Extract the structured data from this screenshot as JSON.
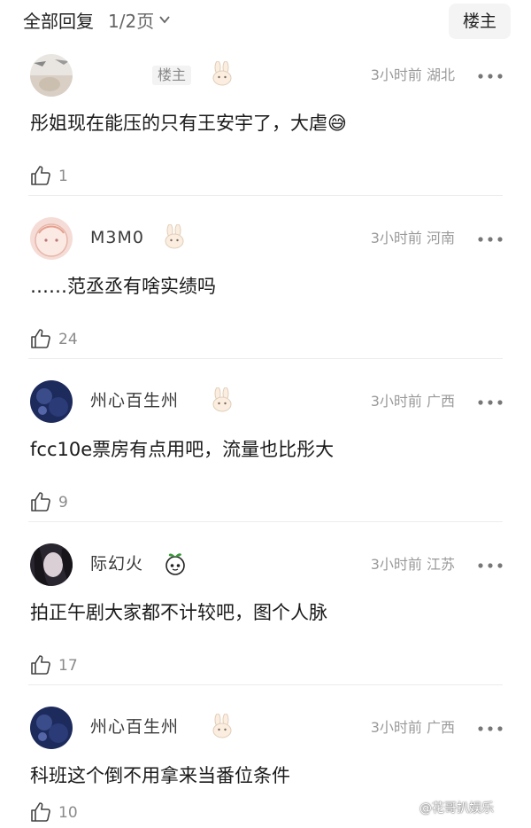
{
  "header": {
    "title": "全部回复",
    "page": "1/2页",
    "poster_button": "楼主"
  },
  "comments": [
    {
      "username": "",
      "tag": "楼主",
      "time": "3小时前",
      "location": "湖北",
      "text": "彤姐现在能压的只有王安宇了，大虐😅",
      "likes": "1"
    },
    {
      "username": "M3M0",
      "tag": "",
      "time": "3小时前",
      "location": "河南",
      "text": "……范丞丞有啥实绩吗",
      "likes": "24"
    },
    {
      "username": "州心百生州",
      "tag": "",
      "time": "3小时前",
      "location": "广西",
      "text": "fcc10e票房有点用吧，流量也比彤大",
      "likes": "9"
    },
    {
      "username": "际幻火",
      "tag": "",
      "time": "3小时前",
      "location": "江苏",
      "text": "拍正午剧大家都不计较吧，图个人脉",
      "likes": "17"
    },
    {
      "username": "州心百生州",
      "tag": "",
      "time": "3小时前",
      "location": "广西",
      "text": "科班这个倒不用拿来当番位条件",
      "likes": "10"
    }
  ],
  "watermark": "@花哥扒娱乐"
}
